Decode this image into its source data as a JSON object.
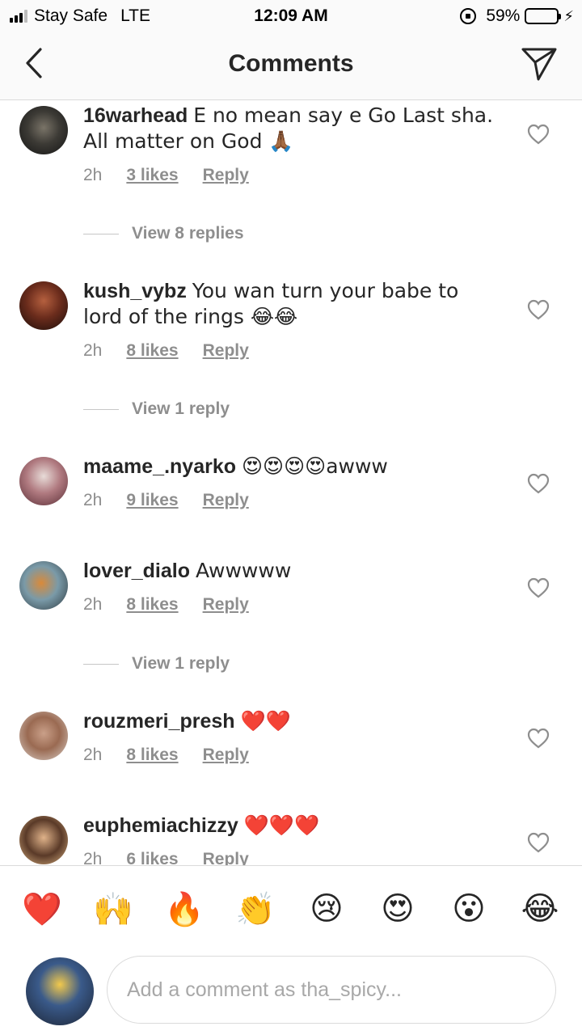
{
  "status_bar": {
    "carrier": "Stay Safe",
    "network": "LTE",
    "time": "12:09 AM",
    "battery": "59%",
    "battery_level": 0.59,
    "battery_color": "#f5c400"
  },
  "header": {
    "title": "Comments",
    "back_icon": "chevron-left-icon",
    "send_icon": "paper-plane-icon"
  },
  "comments": [
    {
      "username": "16warhead",
      "text": "E no mean say e Go Last sha. All matter on God 🙏🏾",
      "time": "2h",
      "likes": "3 likes",
      "reply": "Reply",
      "view_replies": "View 8 replies"
    },
    {
      "username": "kush_vybz",
      "text": "You wan turn your babe to lord of the rings 😂😂",
      "time": "2h",
      "likes": "8 likes",
      "reply": "Reply",
      "view_replies": "View 1 reply"
    },
    {
      "username": "maame_.nyarko",
      "text": "😍😍😍😍awww",
      "time": "2h",
      "likes": "9 likes",
      "reply": "Reply"
    },
    {
      "username": "lover_dialo",
      "text": "Awwwww",
      "time": "2h",
      "likes": "8 likes",
      "reply": "Reply",
      "view_replies": "View 1 reply"
    },
    {
      "username": "rouzmeri_presh",
      "text": "❤️❤️",
      "time": "2h",
      "likes": "8 likes",
      "reply": "Reply"
    },
    {
      "username": "euphemiachizzy",
      "text": "❤️❤️❤️",
      "time": "2h",
      "likes": "6 likes",
      "reply": "Reply"
    }
  ],
  "reactions": [
    "❤️",
    "🙌",
    "🔥",
    "👏",
    "😢",
    "😍",
    "😮",
    "😂"
  ],
  "composer": {
    "placeholder": "Add a comment as tha_spicy..."
  }
}
